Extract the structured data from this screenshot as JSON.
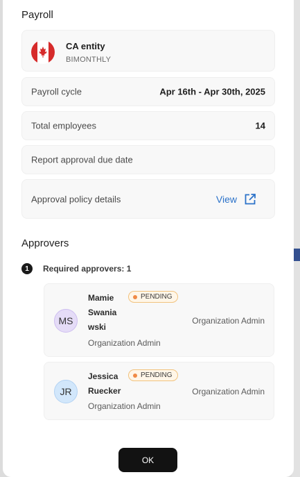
{
  "payroll": {
    "title": "Payroll",
    "entity": {
      "name": "CA entity",
      "frequency": "BIMONTHLY",
      "flag_icon": "canada-flag-icon"
    },
    "rows": [
      {
        "label": "Payroll cycle",
        "value": "Apr 16th - Apr 30th, 2025"
      },
      {
        "label": "Total employees",
        "value": "14"
      },
      {
        "label": "Report approval due date",
        "value": ""
      }
    ],
    "policy": {
      "label": "Approval policy details",
      "link_label": "View",
      "link_icon": "external-link-icon"
    }
  },
  "approvers": {
    "title": "Approvers",
    "step_number": "1",
    "required_label": "Required approvers: 1",
    "list": [
      {
        "initials": "MS",
        "name_lines": [
          "Mamie",
          "Swania",
          "wski"
        ],
        "role": "Organization Admin",
        "status": "PENDING",
        "right_role": "Organization Admin"
      },
      {
        "initials": "JR",
        "name_lines": [
          "Jessica",
          "Ruecker"
        ],
        "role": "Organization Admin",
        "status": "PENDING",
        "right_role": "Organization Admin"
      }
    ]
  },
  "footer": {
    "ok_label": "OK"
  },
  "colors": {
    "accent": "#2b72c9",
    "pending_dot": "#f08a45",
    "button": "#121212"
  }
}
